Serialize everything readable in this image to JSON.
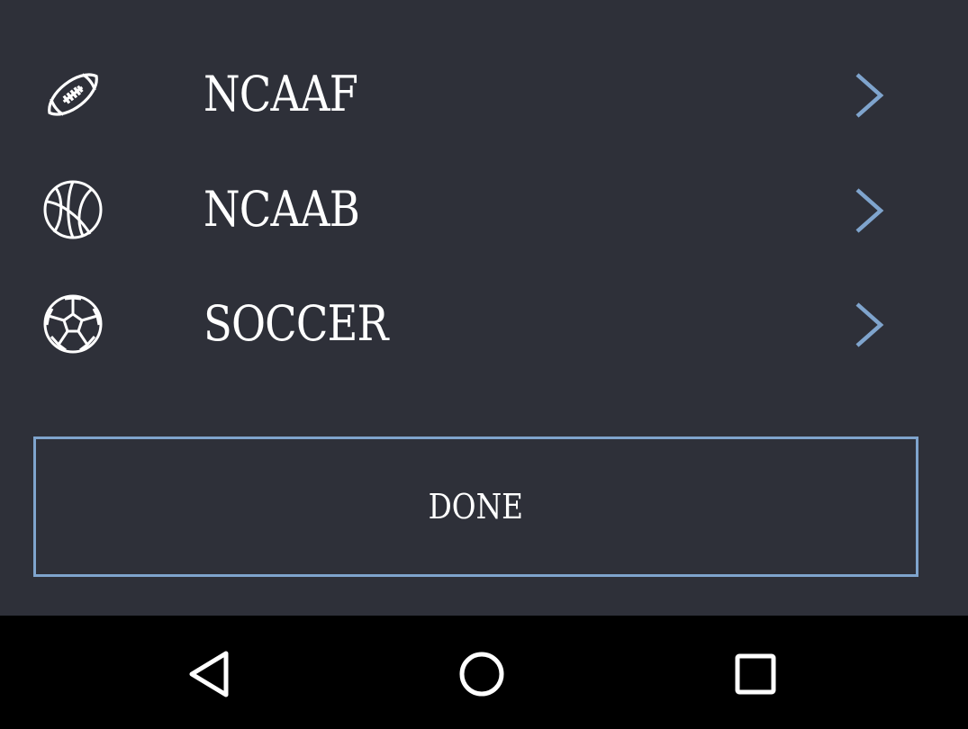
{
  "colors": {
    "background": "#2e3039",
    "accent": "#7fa4cd",
    "text": "#ffffff",
    "navbar": "#000000"
  },
  "sports_list": {
    "items": [
      {
        "label": "NCAAF",
        "icon": "football-icon"
      },
      {
        "label": "NCAAB",
        "icon": "basketball-icon"
      },
      {
        "label": "SOCCER",
        "icon": "soccer-ball-icon"
      }
    ]
  },
  "done_button": {
    "label": "DONE"
  },
  "system_nav": {
    "buttons": [
      "back-icon",
      "home-icon",
      "recents-icon"
    ]
  }
}
